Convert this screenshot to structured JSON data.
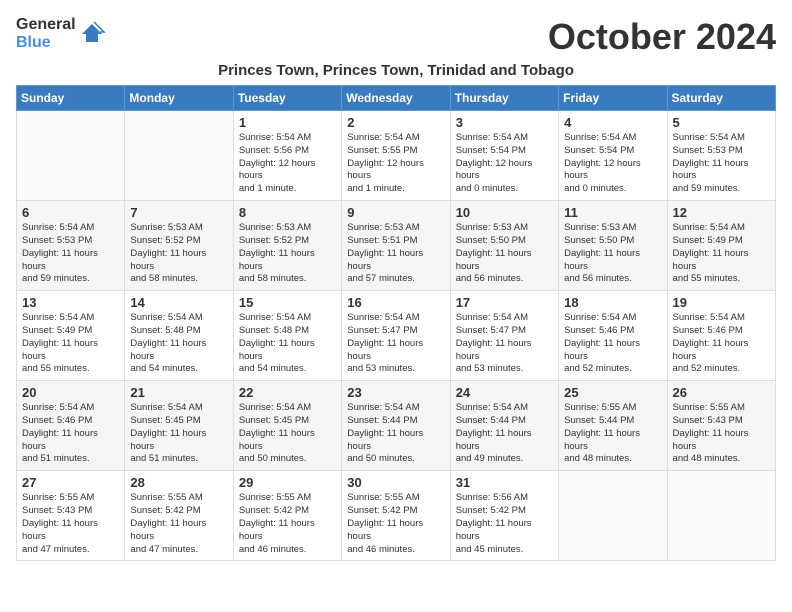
{
  "header": {
    "logo_general": "General",
    "logo_blue": "Blue",
    "month_year": "October 2024",
    "location": "Princes Town, Princes Town, Trinidad and Tobago"
  },
  "days_of_week": [
    "Sunday",
    "Monday",
    "Tuesday",
    "Wednesday",
    "Thursday",
    "Friday",
    "Saturday"
  ],
  "weeks": [
    [
      {
        "day": "",
        "info": ""
      },
      {
        "day": "",
        "info": ""
      },
      {
        "day": "1",
        "info": "Sunrise: 5:54 AM\nSunset: 5:56 PM\nDaylight: 12 hours and 1 minute."
      },
      {
        "day": "2",
        "info": "Sunrise: 5:54 AM\nSunset: 5:55 PM\nDaylight: 12 hours and 1 minute."
      },
      {
        "day": "3",
        "info": "Sunrise: 5:54 AM\nSunset: 5:54 PM\nDaylight: 12 hours and 0 minutes."
      },
      {
        "day": "4",
        "info": "Sunrise: 5:54 AM\nSunset: 5:54 PM\nDaylight: 12 hours and 0 minutes."
      },
      {
        "day": "5",
        "info": "Sunrise: 5:54 AM\nSunset: 5:53 PM\nDaylight: 11 hours and 59 minutes."
      }
    ],
    [
      {
        "day": "6",
        "info": "Sunrise: 5:54 AM\nSunset: 5:53 PM\nDaylight: 11 hours and 59 minutes."
      },
      {
        "day": "7",
        "info": "Sunrise: 5:53 AM\nSunset: 5:52 PM\nDaylight: 11 hours and 58 minutes."
      },
      {
        "day": "8",
        "info": "Sunrise: 5:53 AM\nSunset: 5:52 PM\nDaylight: 11 hours and 58 minutes."
      },
      {
        "day": "9",
        "info": "Sunrise: 5:53 AM\nSunset: 5:51 PM\nDaylight: 11 hours and 57 minutes."
      },
      {
        "day": "10",
        "info": "Sunrise: 5:53 AM\nSunset: 5:50 PM\nDaylight: 11 hours and 56 minutes."
      },
      {
        "day": "11",
        "info": "Sunrise: 5:53 AM\nSunset: 5:50 PM\nDaylight: 11 hours and 56 minutes."
      },
      {
        "day": "12",
        "info": "Sunrise: 5:54 AM\nSunset: 5:49 PM\nDaylight: 11 hours and 55 minutes."
      }
    ],
    [
      {
        "day": "13",
        "info": "Sunrise: 5:54 AM\nSunset: 5:49 PM\nDaylight: 11 hours and 55 minutes."
      },
      {
        "day": "14",
        "info": "Sunrise: 5:54 AM\nSunset: 5:48 PM\nDaylight: 11 hours and 54 minutes."
      },
      {
        "day": "15",
        "info": "Sunrise: 5:54 AM\nSunset: 5:48 PM\nDaylight: 11 hours and 54 minutes."
      },
      {
        "day": "16",
        "info": "Sunrise: 5:54 AM\nSunset: 5:47 PM\nDaylight: 11 hours and 53 minutes."
      },
      {
        "day": "17",
        "info": "Sunrise: 5:54 AM\nSunset: 5:47 PM\nDaylight: 11 hours and 53 minutes."
      },
      {
        "day": "18",
        "info": "Sunrise: 5:54 AM\nSunset: 5:46 PM\nDaylight: 11 hours and 52 minutes."
      },
      {
        "day": "19",
        "info": "Sunrise: 5:54 AM\nSunset: 5:46 PM\nDaylight: 11 hours and 52 minutes."
      }
    ],
    [
      {
        "day": "20",
        "info": "Sunrise: 5:54 AM\nSunset: 5:46 PM\nDaylight: 11 hours and 51 minutes."
      },
      {
        "day": "21",
        "info": "Sunrise: 5:54 AM\nSunset: 5:45 PM\nDaylight: 11 hours and 51 minutes."
      },
      {
        "day": "22",
        "info": "Sunrise: 5:54 AM\nSunset: 5:45 PM\nDaylight: 11 hours and 50 minutes."
      },
      {
        "day": "23",
        "info": "Sunrise: 5:54 AM\nSunset: 5:44 PM\nDaylight: 11 hours and 50 minutes."
      },
      {
        "day": "24",
        "info": "Sunrise: 5:54 AM\nSunset: 5:44 PM\nDaylight: 11 hours and 49 minutes."
      },
      {
        "day": "25",
        "info": "Sunrise: 5:55 AM\nSunset: 5:44 PM\nDaylight: 11 hours and 48 minutes."
      },
      {
        "day": "26",
        "info": "Sunrise: 5:55 AM\nSunset: 5:43 PM\nDaylight: 11 hours and 48 minutes."
      }
    ],
    [
      {
        "day": "27",
        "info": "Sunrise: 5:55 AM\nSunset: 5:43 PM\nDaylight: 11 hours and 47 minutes."
      },
      {
        "day": "28",
        "info": "Sunrise: 5:55 AM\nSunset: 5:42 PM\nDaylight: 11 hours and 47 minutes."
      },
      {
        "day": "29",
        "info": "Sunrise: 5:55 AM\nSunset: 5:42 PM\nDaylight: 11 hours and 46 minutes."
      },
      {
        "day": "30",
        "info": "Sunrise: 5:55 AM\nSunset: 5:42 PM\nDaylight: 11 hours and 46 minutes."
      },
      {
        "day": "31",
        "info": "Sunrise: 5:56 AM\nSunset: 5:42 PM\nDaylight: 11 hours and 45 minutes."
      },
      {
        "day": "",
        "info": ""
      },
      {
        "day": "",
        "info": ""
      }
    ]
  ]
}
